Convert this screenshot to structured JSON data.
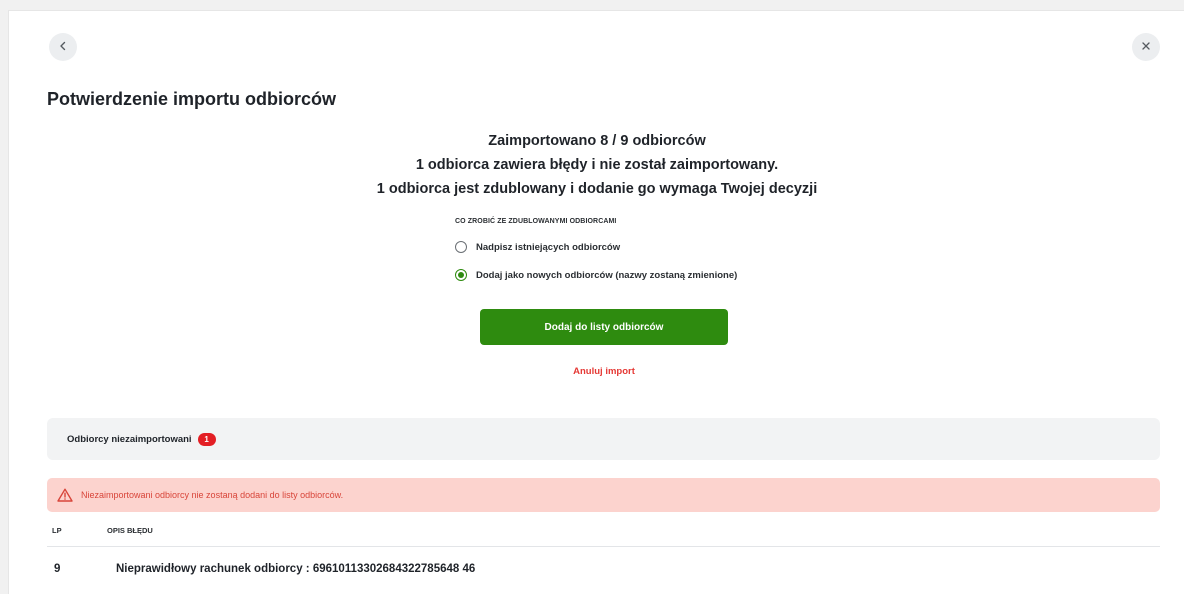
{
  "header": {
    "title": "Potwierdzenie importu odbiorców",
    "back_icon": "chevron-left-icon",
    "close_icon": "close-icon"
  },
  "summary": {
    "line1": "Zaimportowano 8 / 9 odbiorców",
    "line2": "1 odbiorca zawiera błędy i nie został zaimportowany.",
    "line3": "1 odbiorca jest zdublowany i dodanie go wymaga Twojej decyzji"
  },
  "duplicates": {
    "label": "CO ZROBIĆ ZE ZDUBLOWANYMI ODBIORCAMI",
    "options": [
      {
        "label": "Nadpisz istniejących odbiorców",
        "checked": false
      },
      {
        "label": "Dodaj jako nowych odbiorców (nazwy zostaną zmienione)",
        "checked": true
      }
    ]
  },
  "actions": {
    "primary_label": "Dodaj do listy odbiorców",
    "cancel_label": "Anuluj import"
  },
  "not_imported": {
    "title": "Odbiorcy niezaimportowani",
    "count": "1",
    "alert_icon": "warning-icon",
    "alert_text": "Niezaimportowani odbiorcy nie zostaną dodani do listy odbiorców.",
    "columns": [
      "LP",
      "OPIS BŁĘDU"
    ],
    "rows": [
      {
        "lp": "9",
        "description": "Nieprawidłowy rachunek odbiorcy : 69610113302684322785648 46"
      }
    ]
  },
  "colors": {
    "primary": "#2e8b0f",
    "danger": "#e53935",
    "badge": "#e31e24",
    "alert_bg": "#fcd3ce",
    "section_bg": "#f2f3f4"
  }
}
